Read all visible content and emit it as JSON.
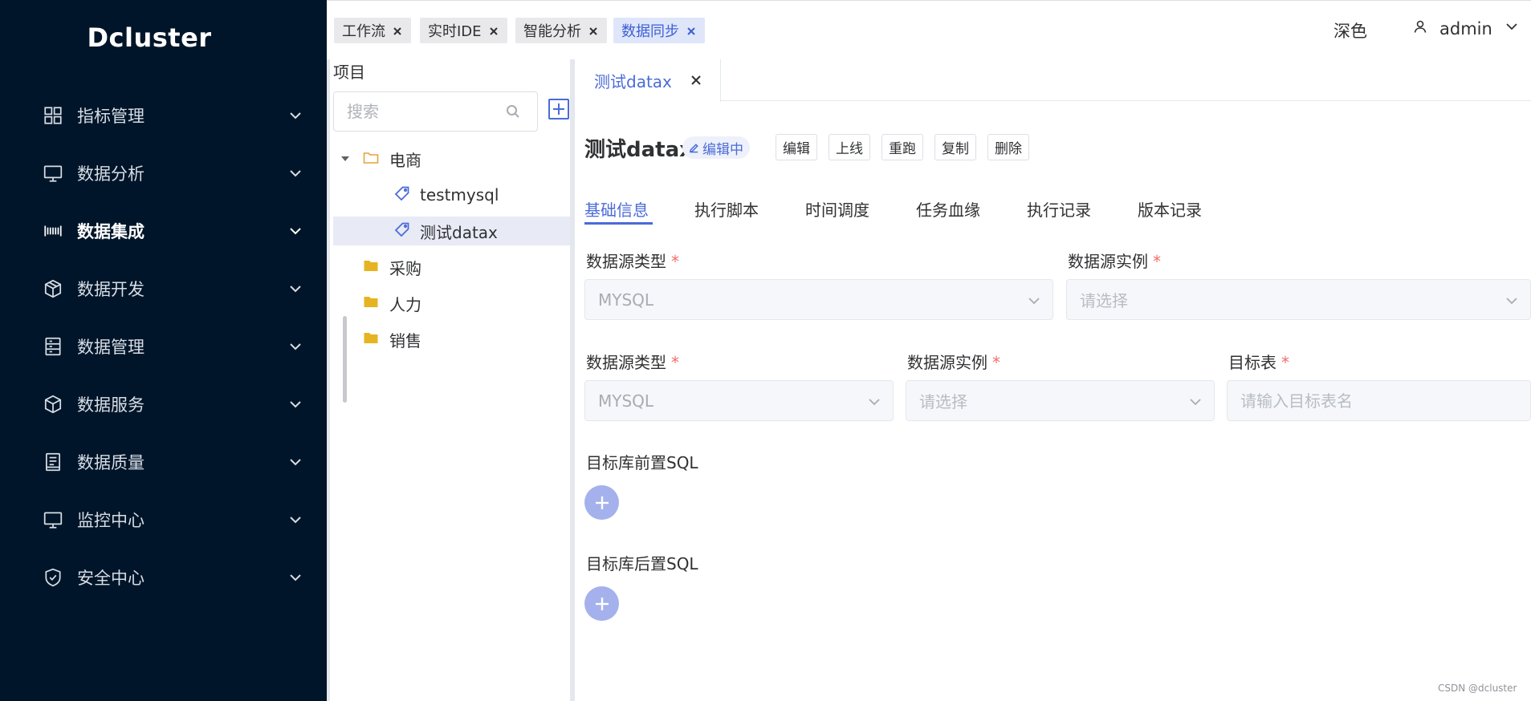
{
  "app": {
    "logo": "Dcluster"
  },
  "sidebar": {
    "items": [
      {
        "label": "指标管理",
        "icon": "grid-icon"
      },
      {
        "label": "数据分析",
        "icon": "monitor-icon"
      },
      {
        "label": "数据集成",
        "icon": "barcode-icon",
        "active": true
      },
      {
        "label": "数据开发",
        "icon": "cube-icon"
      },
      {
        "label": "数据管理",
        "icon": "server-icon"
      },
      {
        "label": "数据服务",
        "icon": "box-icon"
      },
      {
        "label": "数据质量",
        "icon": "report-icon"
      },
      {
        "label": "监控中心",
        "icon": "monitor-icon"
      },
      {
        "label": "安全中心",
        "icon": "shield-icon"
      }
    ]
  },
  "header": {
    "tabs": [
      {
        "label": "工作流"
      },
      {
        "label": "实时IDE"
      },
      {
        "label": "智能分析"
      },
      {
        "label": "数据同步",
        "active": true
      }
    ],
    "theme_label": "深色",
    "username": "admin"
  },
  "project_panel": {
    "title": "项目",
    "search_placeholder": "搜索",
    "tree": [
      {
        "label": "电商",
        "type": "folder-open",
        "expanded": true
      },
      {
        "label": "testmysql",
        "type": "task"
      },
      {
        "label": "测试datax",
        "type": "task",
        "selected": true
      },
      {
        "label": "采购",
        "type": "folder"
      },
      {
        "label": "人力",
        "type": "folder"
      },
      {
        "label": "销售",
        "type": "folder"
      }
    ]
  },
  "editor": {
    "open_tab": "测试datax",
    "task_name": "测试datax",
    "status": "编辑中",
    "actions": [
      "编辑",
      "上线",
      "重跑",
      "复制",
      "删除"
    ],
    "sub_tabs": [
      "基础信息",
      "执行脚本",
      "时间调度",
      "任务血缘",
      "执行记录",
      "版本记录"
    ],
    "active_sub_tab": "基础信息",
    "source": {
      "type_label": "数据源类型",
      "type_value": "MYSQL",
      "instance_label": "数据源实例",
      "instance_placeholder": "请选择"
    },
    "target": {
      "type_label": "数据源类型",
      "type_value": "MYSQL",
      "instance_label": "数据源实例",
      "instance_placeholder": "请选择",
      "table_label": "目标表",
      "table_placeholder": "请输入目标表名"
    },
    "pre_sql_label": "目标库前置SQL",
    "post_sql_label": "目标库后置SQL",
    "required_mark": "*"
  },
  "watermark": "CSDN @dcluster",
  "colors": {
    "sidebar_bg": "#001529",
    "accent": "#4b6bd8",
    "required": "#f56c6c"
  }
}
